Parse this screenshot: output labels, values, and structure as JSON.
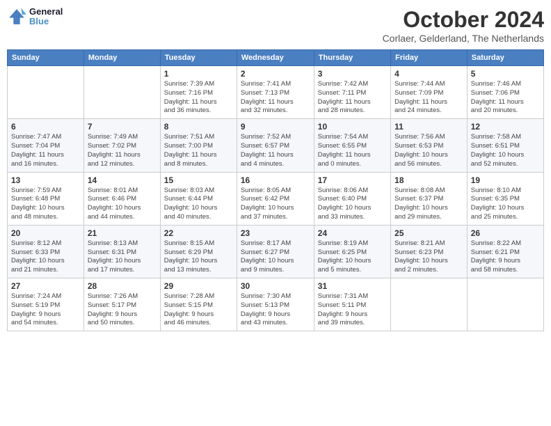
{
  "logo": {
    "line1": "General",
    "line2": "Blue"
  },
  "title": "October 2024",
  "subtitle": "Corlaer, Gelderland, The Netherlands",
  "days_of_week": [
    "Sunday",
    "Monday",
    "Tuesday",
    "Wednesday",
    "Thursday",
    "Friday",
    "Saturday"
  ],
  "rows": [
    [
      {
        "day": "",
        "info": ""
      },
      {
        "day": "",
        "info": ""
      },
      {
        "day": "1",
        "info": "Sunrise: 7:39 AM\nSunset: 7:16 PM\nDaylight: 11 hours\nand 36 minutes."
      },
      {
        "day": "2",
        "info": "Sunrise: 7:41 AM\nSunset: 7:13 PM\nDaylight: 11 hours\nand 32 minutes."
      },
      {
        "day": "3",
        "info": "Sunrise: 7:42 AM\nSunset: 7:11 PM\nDaylight: 11 hours\nand 28 minutes."
      },
      {
        "day": "4",
        "info": "Sunrise: 7:44 AM\nSunset: 7:09 PM\nDaylight: 11 hours\nand 24 minutes."
      },
      {
        "day": "5",
        "info": "Sunrise: 7:46 AM\nSunset: 7:06 PM\nDaylight: 11 hours\nand 20 minutes."
      }
    ],
    [
      {
        "day": "6",
        "info": "Sunrise: 7:47 AM\nSunset: 7:04 PM\nDaylight: 11 hours\nand 16 minutes."
      },
      {
        "day": "7",
        "info": "Sunrise: 7:49 AM\nSunset: 7:02 PM\nDaylight: 11 hours\nand 12 minutes."
      },
      {
        "day": "8",
        "info": "Sunrise: 7:51 AM\nSunset: 7:00 PM\nDaylight: 11 hours\nand 8 minutes."
      },
      {
        "day": "9",
        "info": "Sunrise: 7:52 AM\nSunset: 6:57 PM\nDaylight: 11 hours\nand 4 minutes."
      },
      {
        "day": "10",
        "info": "Sunrise: 7:54 AM\nSunset: 6:55 PM\nDaylight: 11 hours\nand 0 minutes."
      },
      {
        "day": "11",
        "info": "Sunrise: 7:56 AM\nSunset: 6:53 PM\nDaylight: 10 hours\nand 56 minutes."
      },
      {
        "day": "12",
        "info": "Sunrise: 7:58 AM\nSunset: 6:51 PM\nDaylight: 10 hours\nand 52 minutes."
      }
    ],
    [
      {
        "day": "13",
        "info": "Sunrise: 7:59 AM\nSunset: 6:48 PM\nDaylight: 10 hours\nand 48 minutes."
      },
      {
        "day": "14",
        "info": "Sunrise: 8:01 AM\nSunset: 6:46 PM\nDaylight: 10 hours\nand 44 minutes."
      },
      {
        "day": "15",
        "info": "Sunrise: 8:03 AM\nSunset: 6:44 PM\nDaylight: 10 hours\nand 40 minutes."
      },
      {
        "day": "16",
        "info": "Sunrise: 8:05 AM\nSunset: 6:42 PM\nDaylight: 10 hours\nand 37 minutes."
      },
      {
        "day": "17",
        "info": "Sunrise: 8:06 AM\nSunset: 6:40 PM\nDaylight: 10 hours\nand 33 minutes."
      },
      {
        "day": "18",
        "info": "Sunrise: 8:08 AM\nSunset: 6:37 PM\nDaylight: 10 hours\nand 29 minutes."
      },
      {
        "day": "19",
        "info": "Sunrise: 8:10 AM\nSunset: 6:35 PM\nDaylight: 10 hours\nand 25 minutes."
      }
    ],
    [
      {
        "day": "20",
        "info": "Sunrise: 8:12 AM\nSunset: 6:33 PM\nDaylight: 10 hours\nand 21 minutes."
      },
      {
        "day": "21",
        "info": "Sunrise: 8:13 AM\nSunset: 6:31 PM\nDaylight: 10 hours\nand 17 minutes."
      },
      {
        "day": "22",
        "info": "Sunrise: 8:15 AM\nSunset: 6:29 PM\nDaylight: 10 hours\nand 13 minutes."
      },
      {
        "day": "23",
        "info": "Sunrise: 8:17 AM\nSunset: 6:27 PM\nDaylight: 10 hours\nand 9 minutes."
      },
      {
        "day": "24",
        "info": "Sunrise: 8:19 AM\nSunset: 6:25 PM\nDaylight: 10 hours\nand 5 minutes."
      },
      {
        "day": "25",
        "info": "Sunrise: 8:21 AM\nSunset: 6:23 PM\nDaylight: 10 hours\nand 2 minutes."
      },
      {
        "day": "26",
        "info": "Sunrise: 8:22 AM\nSunset: 6:21 PM\nDaylight: 9 hours\nand 58 minutes."
      }
    ],
    [
      {
        "day": "27",
        "info": "Sunrise: 7:24 AM\nSunset: 5:19 PM\nDaylight: 9 hours\nand 54 minutes."
      },
      {
        "day": "28",
        "info": "Sunrise: 7:26 AM\nSunset: 5:17 PM\nDaylight: 9 hours\nand 50 minutes."
      },
      {
        "day": "29",
        "info": "Sunrise: 7:28 AM\nSunset: 5:15 PM\nDaylight: 9 hours\nand 46 minutes."
      },
      {
        "day": "30",
        "info": "Sunrise: 7:30 AM\nSunset: 5:13 PM\nDaylight: 9 hours\nand 43 minutes."
      },
      {
        "day": "31",
        "info": "Sunrise: 7:31 AM\nSunset: 5:11 PM\nDaylight: 9 hours\nand 39 minutes."
      },
      {
        "day": "",
        "info": ""
      },
      {
        "day": "",
        "info": ""
      }
    ]
  ]
}
